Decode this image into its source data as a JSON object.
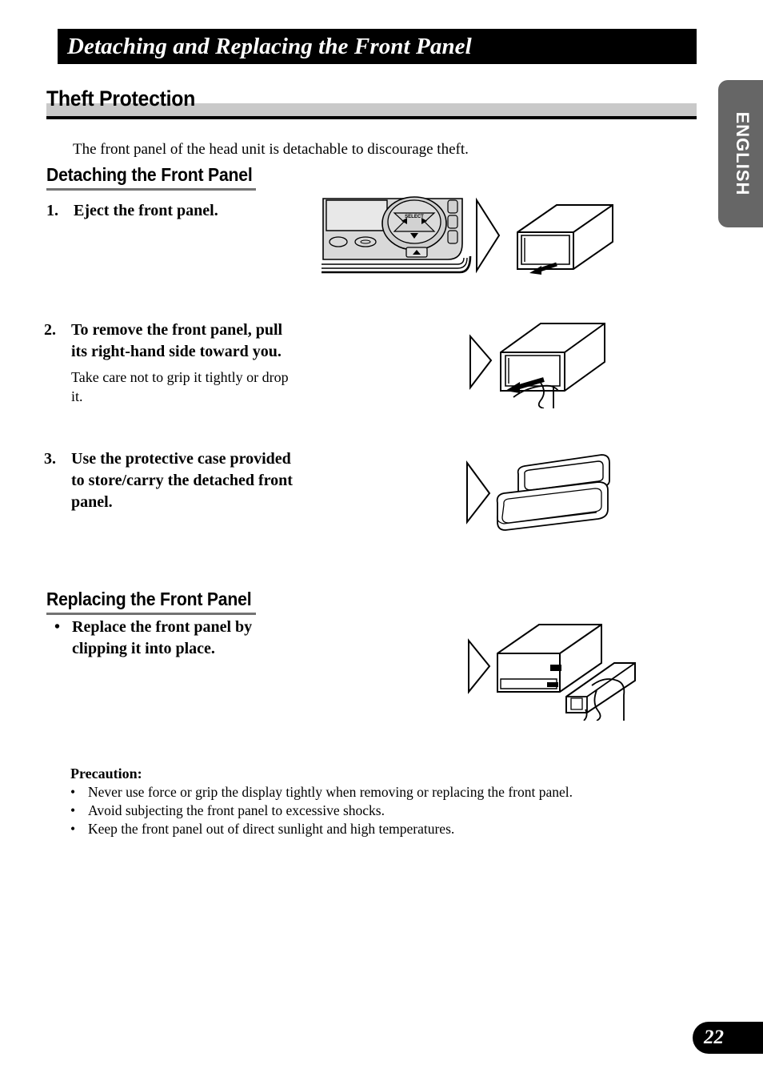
{
  "page": {
    "title": "Detaching and Replacing the Front Panel",
    "number": "22",
    "language_tab": "ENGLISH"
  },
  "section": {
    "heading": "Theft Protection",
    "intro": "The front panel of the head unit is detachable to discourage theft."
  },
  "detaching": {
    "heading": "Detaching the Front Panel",
    "steps": [
      {
        "num": "1.",
        "title": "Eject the front panel.",
        "note": ""
      },
      {
        "num": "2.",
        "title": "To remove the front panel, pull its right-hand side toward you.",
        "note": "Take care not to grip it tightly or drop it."
      },
      {
        "num": "3.",
        "title": "Use the protective case provided to store/carry the detached front panel.",
        "note": ""
      }
    ]
  },
  "replacing": {
    "heading": "Replacing the Front Panel",
    "bullet_marker": "•",
    "bullet_text": "Replace the front panel by clipping it into place."
  },
  "precaution": {
    "title": "Precaution:",
    "bullet_marker": "•",
    "items": [
      "Never use force or grip the display tightly when removing or replacing the front panel.",
      "Avoid subjecting the front panel to excessive shocks.",
      "Keep the front panel out of direct sunlight and high temperatures."
    ]
  },
  "figures": {
    "head_unit_face": {
      "select_label": "SELECT",
      "eject_label": "▲"
    }
  },
  "colors": {
    "banner_bg": "#000000",
    "banner_text": "#ffffff",
    "section_band": "#c9c9c9",
    "section_rule": "#000000",
    "subsection_rule": "#737373",
    "tab_bg": "#666666",
    "page_pill_bg": "#000000",
    "body_text": "#000000"
  }
}
